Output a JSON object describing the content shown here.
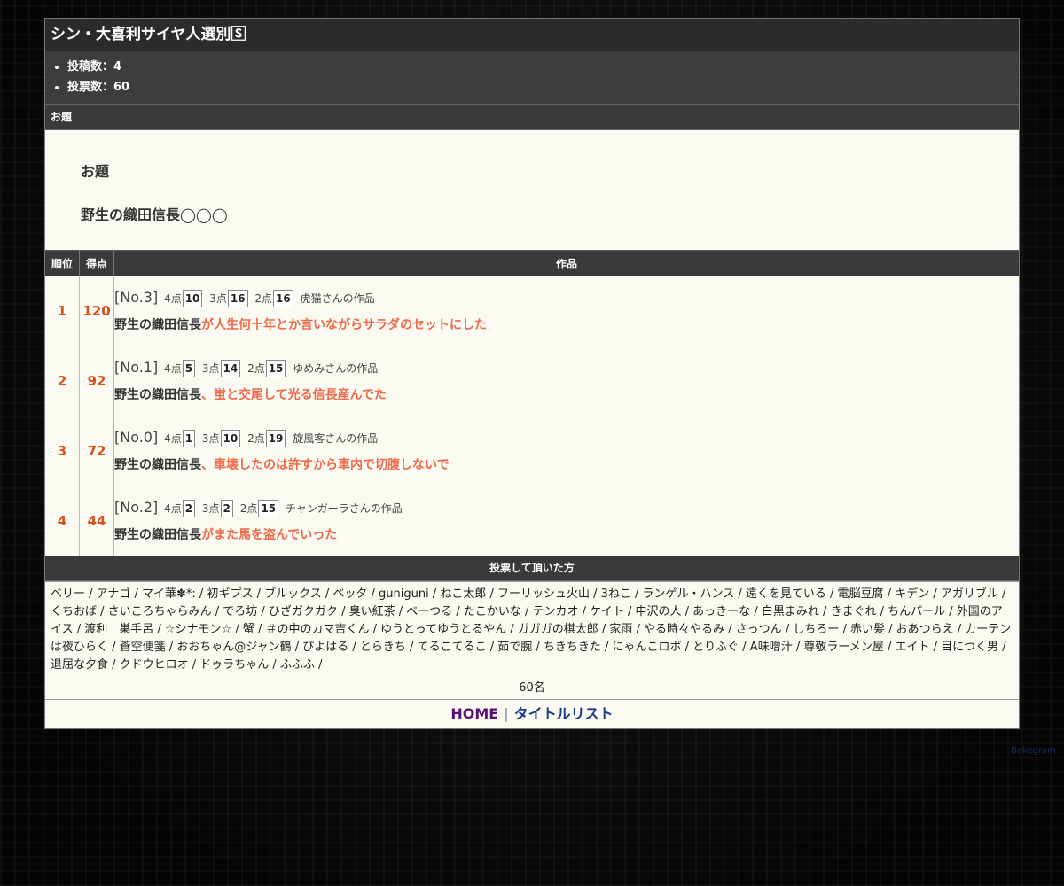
{
  "page": {
    "title": "シン・大喜利サイヤ人選別🅂",
    "stats": [
      "投稿数：4",
      "投票数：60"
    ]
  },
  "theme": {
    "section_label": "お題",
    "heading": "お題",
    "text": "野生の織田信長◯◯◯"
  },
  "table": {
    "headers": [
      "順位",
      "得点",
      "作品"
    ],
    "rows": [
      {
        "rank": "1",
        "score": "120",
        "no": "[No.3]",
        "p4_label": "4点",
        "p4": "10",
        "p3_label": "3点",
        "p3": "16",
        "p2_label": "2点",
        "p2": "16",
        "author": "虎猫さんの作品",
        "base": "野生の織田信長",
        "answer": "が人生何十年とか言いながらサラダのセットにした"
      },
      {
        "rank": "2",
        "score": "92",
        "no": "[No.1]",
        "p4_label": "4点",
        "p4": "5",
        "p3_label": "3点",
        "p3": "14",
        "p2_label": "2点",
        "p2": "15",
        "author": "ゆめみさんの作品",
        "base": "野生の織田信長",
        "answer": "、蛍と交尾して光る信長産んでた"
      },
      {
        "rank": "3",
        "score": "72",
        "no": "[No.0]",
        "p4_label": "4点",
        "p4": "1",
        "p3_label": "3点",
        "p3": "10",
        "p2_label": "2点",
        "p2": "19",
        "author": "旋風客さんの作品",
        "base": "野生の織田信長",
        "answer": "、車壊したのは許すから車内で切腹しないで"
      },
      {
        "rank": "4",
        "score": "44",
        "no": "[No.2]",
        "p4_label": "4点",
        "p4": "2",
        "p3_label": "3点",
        "p3": "2",
        "p2_label": "2点",
        "p2": "15",
        "author": "チャンガーラさんの作品",
        "base": "野生の織田信長",
        "answer": "がまた馬を盗んでいった"
      }
    ]
  },
  "voters": {
    "section_label": "投票して頂いた方",
    "names": "ベリー / アナゴ / マイ華✽*: / 初ギプス / ブルックス / ベッタ / guniguni / ねこ太郎 / フーリッシュ火山 / 3ねこ / ランゲル・ハンス / 遠くを見ている / 電脳豆腐 / キデン / アガリブル / くちおば / さいころちゃらみん / でろ坊 / ひざガクガク / 臭い紅茶 / べーつる / たこかいな / テンカオ / ケイト / 中沢の人 / あっきーな / 白黒まみれ / きまぐれ / ちんパール / 外国のアイス / 渡利　巣手呂 / ☆シナモン☆ / 蟹 / ＃の中のカマ吉くん / ゆうとってゆうとるやん / ガガガの棋太郎 / 家雨 / やる時々やるみ / さっつん / しちろー / 赤い髪 / おあつらえ / カーテンは夜ひらく / 蒼空便箋 / おおちゃん@ジャン鶴 / ぴよはる / とらきち / てるこてるこ / 茹で腕 / ちきちきた / にゃんこロボ / とりふぐ / A味噌汁 / 尊敬ラーメン屋 / エイト / 目につく男 / 退屈な夕食 / クドウヒロオ / ドゥラちゃん / ふふふ /",
    "count": "60名"
  },
  "footer": {
    "home": "HOME",
    "separator": "|",
    "title_list": "タイトルリスト"
  },
  "credit": "Bokegram"
}
